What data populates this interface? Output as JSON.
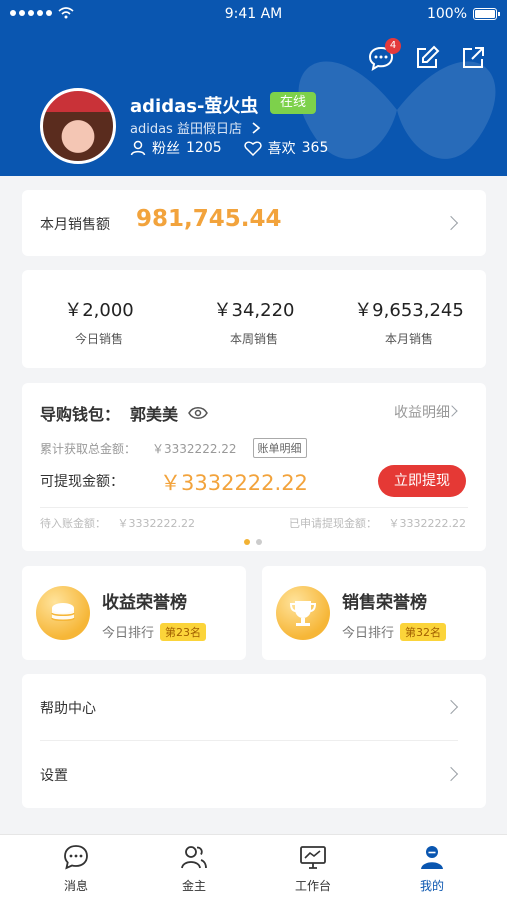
{
  "status_bar": {
    "time": "9:41 AM",
    "battery": "100%"
  },
  "header": {
    "message_badge": "4"
  },
  "profile": {
    "name": "adidas-萤火虫",
    "status": "在线",
    "store": "adidas 益田假日店",
    "fans_label": "粉丝",
    "fans_count": "1205",
    "likes_label": "喜欢",
    "likes_count": "365"
  },
  "monthly_sales": {
    "label": "本月销售额",
    "value": "981,745.44"
  },
  "sales_summary": [
    {
      "value": "￥2,000",
      "label": "今日销售"
    },
    {
      "value": "￥34,220",
      "label": "本周销售"
    },
    {
      "value": "￥9,653,245",
      "label": "本月销售"
    }
  ],
  "wallet": {
    "title": "导购钱包：",
    "owner": "郭美美",
    "detail_link": "收益明细",
    "total_label": "累计获取总金额：",
    "total_value": "￥3332222.22",
    "bill_link": "账单明细",
    "available_label": "可提现金额：",
    "available_value": "￥3332222.22",
    "withdraw_button": "立即提现",
    "pending_label": "待入账金额：",
    "pending_value": "￥3332222.22",
    "applied_label": "已申请提现金额：",
    "applied_value": "￥3332222.22",
    "page_index": 1,
    "page_count": 2
  },
  "rankings": [
    {
      "title": "收益荣誉榜",
      "sub": "今日排行",
      "tag": "第23名",
      "icon": "coins-icon"
    },
    {
      "title": "销售荣誉榜",
      "sub": "今日排行",
      "tag": "第32名",
      "icon": "trophy-icon"
    }
  ],
  "menu": [
    {
      "label": "帮助中心"
    },
    {
      "label": "设置"
    }
  ],
  "tabs": [
    {
      "label": "消息",
      "icon": "chat-icon"
    },
    {
      "label": "金主",
      "icon": "users-icon"
    },
    {
      "label": "工作台",
      "icon": "monitor-icon"
    },
    {
      "label": "我的",
      "icon": "person-icon",
      "active": true
    }
  ],
  "colors": {
    "brand": "#0a56b0",
    "accent": "#f2a33c",
    "danger": "#e53935",
    "online": "#7dd14b"
  }
}
